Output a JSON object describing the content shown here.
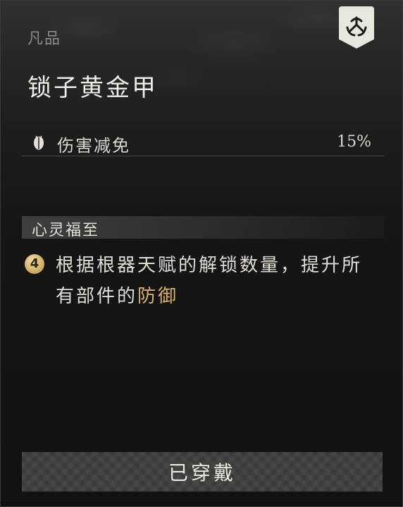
{
  "item": {
    "rarity": "凡品",
    "name": "锁子黄金甲",
    "emblem_icon": "triskelion-emblem-icon"
  },
  "stat": {
    "icon": "shield-beetle-icon",
    "label": "伤害减免",
    "value": "15%"
  },
  "set_bonus": {
    "title": "心灵福至",
    "badge": "4",
    "desc_prefix": "根据根器天赋的解锁数量，提升所有部件的",
    "desc_highlight": "防御",
    "highlight_color": "#d9b46a"
  },
  "button": {
    "label": "已穿戴"
  }
}
